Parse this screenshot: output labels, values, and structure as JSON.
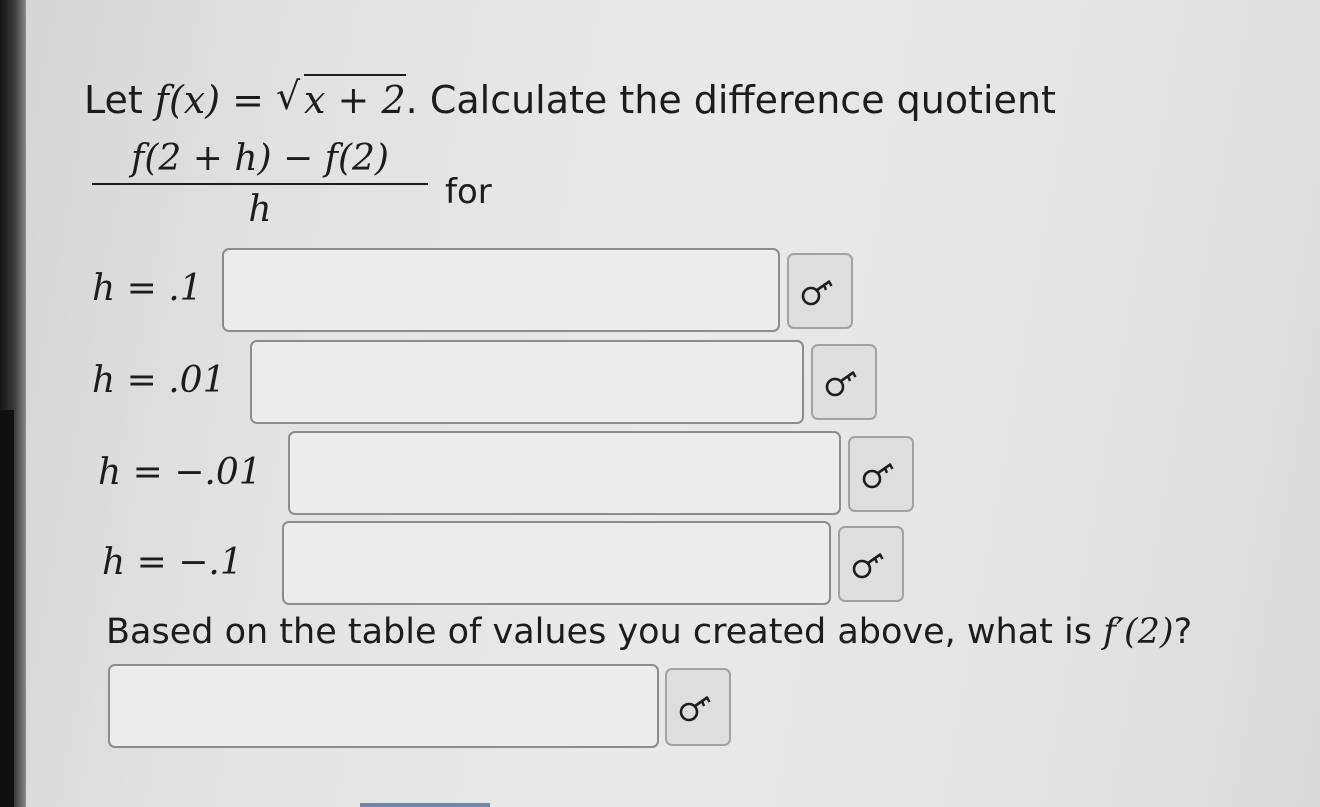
{
  "problem": {
    "intro": "Let",
    "func_lhs": "f(x) =",
    "radicand": "x + 2",
    "intro_tail": ". Calculate the difference quotient",
    "numerator": "f(2 + h) − f(2)",
    "denominator": "h",
    "for_word": "for"
  },
  "rows": [
    {
      "label": "h = .1",
      "value": ""
    },
    {
      "label": "h = .01",
      "value": ""
    },
    {
      "label": "h = −.01",
      "value": ""
    },
    {
      "label": "h = −.1",
      "value": ""
    }
  ],
  "question": {
    "text": "Based on the table of values you created above, what is",
    "expr": "f′(2)",
    "tail": "?",
    "answer_value": ""
  },
  "icons": {
    "answer_button": "key-icon"
  },
  "colors": {
    "background": "#e6e6e4",
    "text": "#1c1c1c",
    "box_border": "#8c8c8a"
  }
}
